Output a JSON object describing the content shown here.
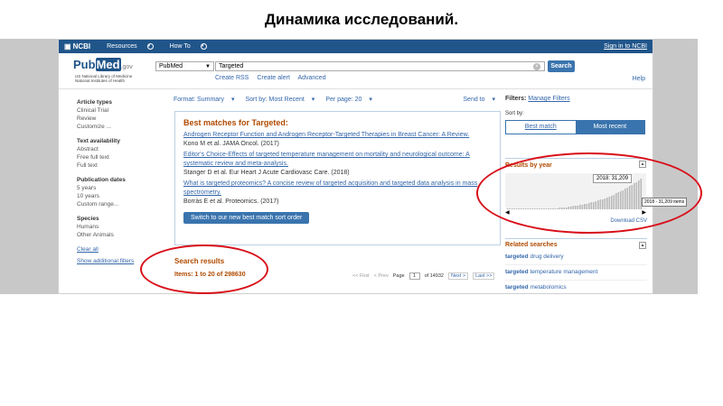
{
  "slide_title": "Динамика исследований.",
  "topbar": {
    "ncbi": "NCBI",
    "resources": "Resources",
    "howto": "How To",
    "signin": "Sign in to NCBI"
  },
  "header": {
    "logo_pub": "Pub",
    "logo_med": "Med",
    "logo_gov": ".gov",
    "logo_sub1": "US National Library of Medicine",
    "logo_sub2": "National Institutes of Health",
    "db_value": "PubMed",
    "search_value": "Targeted",
    "search_btn": "Search",
    "links": [
      "Create RSS",
      "Create alert",
      "Advanced"
    ],
    "help": "Help"
  },
  "left_filters": [
    {
      "heading": "Article types",
      "items": [
        "Clinical Trial",
        "Review",
        "Customize ..."
      ]
    },
    {
      "heading": "Text availability",
      "items": [
        "Abstract",
        "Free full text",
        "Full text"
      ]
    },
    {
      "heading": "Publication dates",
      "items": [
        "5 years",
        "10 years",
        "Custom range..."
      ]
    },
    {
      "heading": "Species",
      "items": [
        "Humans",
        "Other Animals"
      ]
    }
  ],
  "left_links": {
    "clear": "Clear all",
    "show": "Show additional filters"
  },
  "format_bar": {
    "format": "Format: Summary",
    "sort": "Sort by: Most Recent",
    "perpage": "Per page: 20",
    "send": "Send to"
  },
  "best_matches": {
    "title": "Best matches for Targeted:",
    "articles": [
      {
        "title": "Androgen Receptor Function and Androgen Receptor-Targeted Therapies in Breast Cancer: A Review.",
        "cite": "Kono M et al. JAMA Oncol. (2017)"
      },
      {
        "title": "Editor's Choice-Effects of targeted temperature management on mortality and neurological outcome: A systematic review and meta-analysis.",
        "cite": "Stanger D et al. Eur Heart J Acute Cardiovasc Care. (2018)"
      },
      {
        "title": "What is targeted proteomics? A concise review of targeted acquisition and targeted data analysis in mass spectrometry.",
        "cite": "Borràs E et al. Proteomics. (2017)"
      }
    ],
    "switch_btn": "Switch to our new best match sort order"
  },
  "results": {
    "title": "Search results",
    "items": "Items: 1 to 20 of 298630"
  },
  "pager": {
    "first": "<< First",
    "prev": "< Prev",
    "page_label": "Page",
    "page_value": "1",
    "of": "of 14932",
    "next": "Next >",
    "last": "Last >>"
  },
  "right": {
    "filters_label": "Filters:",
    "manage": "Manage Filters",
    "sortby": "Sort by:",
    "best_match": "Best match",
    "most_recent": "Most recent",
    "results_by_year": "Results by year",
    "tooltip": "2018: 31,209",
    "download": "Download CSV",
    "callout": "2018 - 31,209 items",
    "related_title": "Related searches",
    "related": [
      {
        "b": "targeted",
        "rest": "drug delivery"
      },
      {
        "b": "targeted",
        "rest": "temperature management"
      },
      {
        "b": "targeted",
        "rest": "metabolomics"
      }
    ]
  },
  "colors": {
    "accent": "#20558a",
    "highlight_orange": "#b04a00",
    "annotation_red": "#d8101a"
  }
}
